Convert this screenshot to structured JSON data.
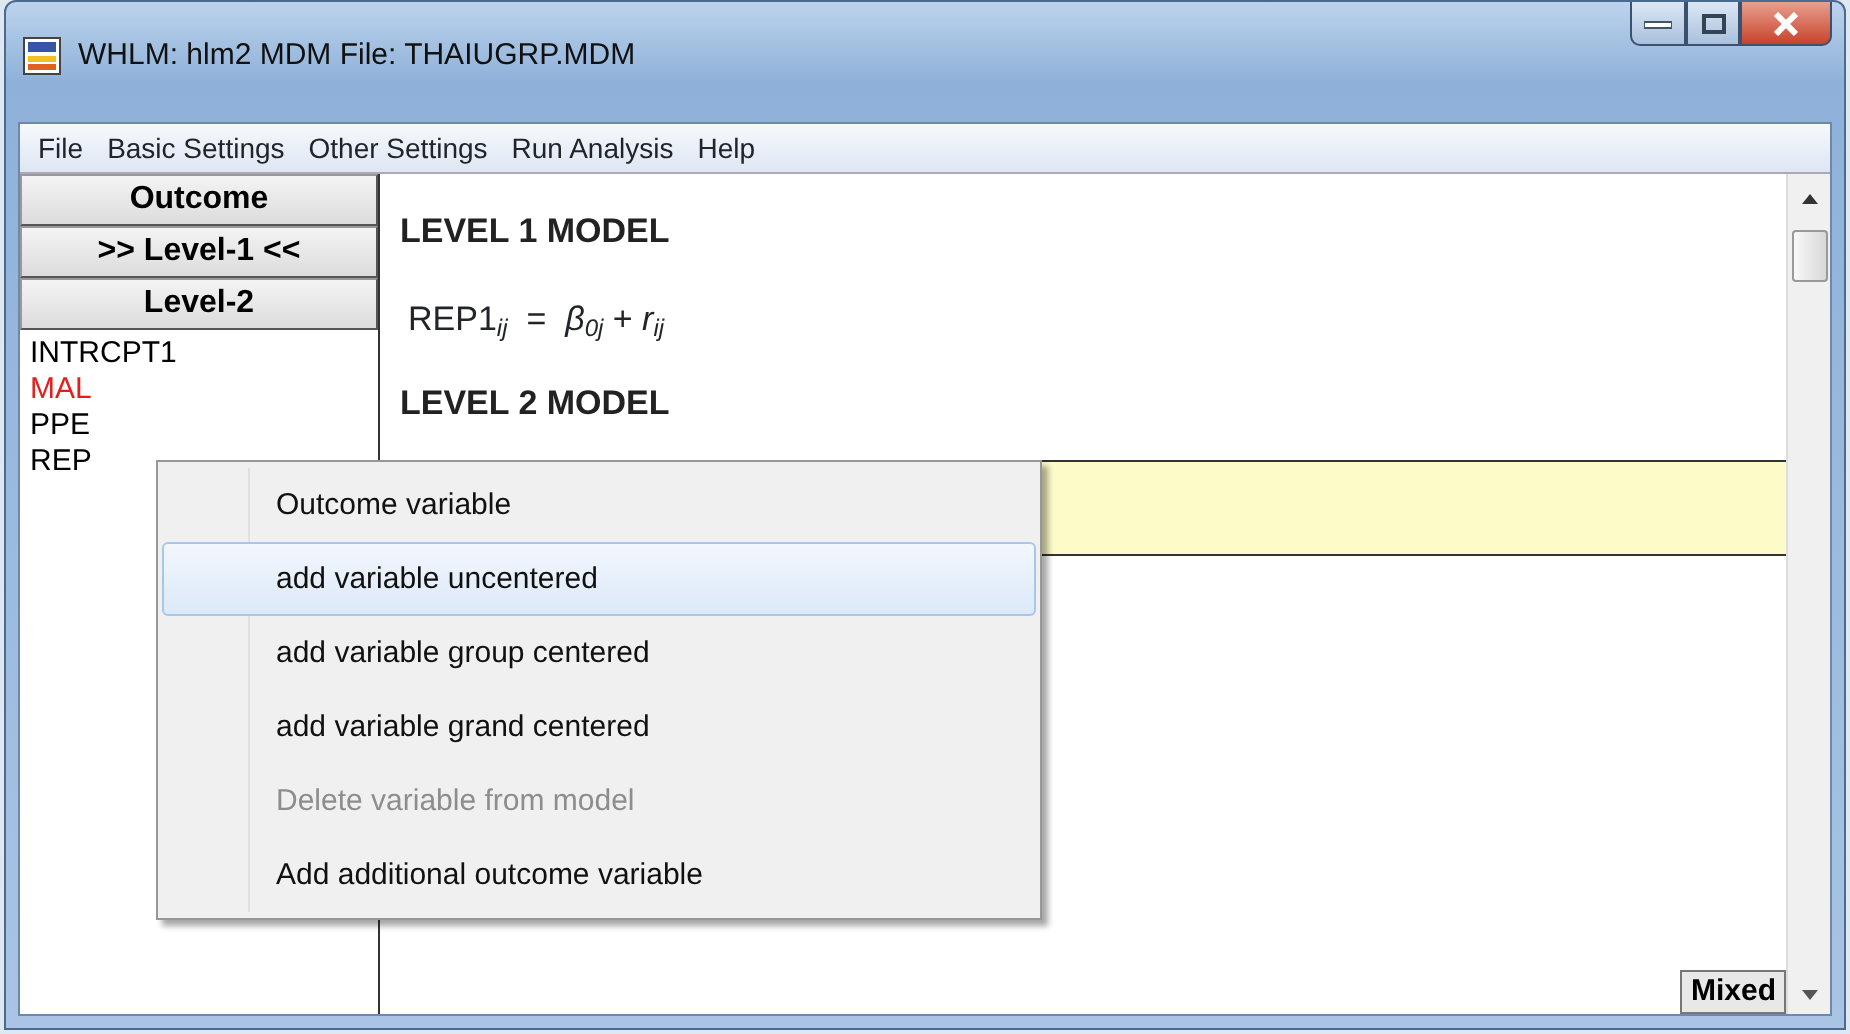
{
  "window": {
    "title": "WHLM: hlm2 MDM File: THAIUGRP.MDM"
  },
  "menu_bar": [
    "File",
    "Basic Settings",
    "Other Settings",
    "Run Analysis",
    "Help"
  ],
  "model_buttons": [
    {
      "label": "Outcome"
    },
    {
      "label": ">> Level-1 <<"
    },
    {
      "label": "Level-2"
    }
  ],
  "variables": [
    {
      "name": "INTRCPT1",
      "color": "#000000"
    },
    {
      "name": "MAL",
      "color": "#e0201c"
    },
    {
      "name": "PPE",
      "color": "#000000"
    },
    {
      "name": "REP",
      "color": "#000000"
    }
  ],
  "model": {
    "level1_heading": "LEVEL 1 MODEL",
    "level1_equation": "REP1$_{ij}$  =  *β*$_{0j}$ + *r*$_{ij}$",
    "level2_heading": "LEVEL 2 MODEL"
  },
  "context_menu": [
    {
      "label": "Outcome variable",
      "highlighted": false,
      "disabled": false
    },
    {
      "label": "add variable uncentered",
      "highlighted": true,
      "disabled": false
    },
    {
      "label": "add variable group centered",
      "highlighted": false,
      "disabled": false
    },
    {
      "label": "add variable grand centered",
      "highlighted": false,
      "disabled": false
    },
    {
      "label": "Delete variable from model",
      "highlighted": false,
      "disabled": true
    },
    {
      "label": "Add additional outcome variable",
      "highlighted": false,
      "disabled": false
    }
  ],
  "mode_button": "Mixed"
}
